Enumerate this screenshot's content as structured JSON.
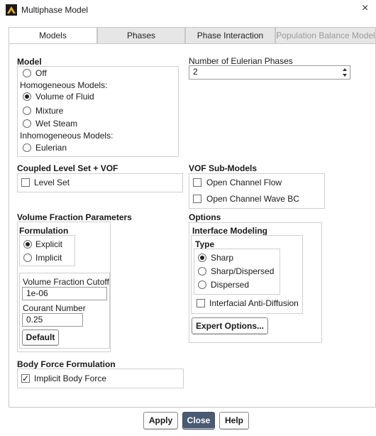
{
  "window": {
    "title": "Multiphase Model",
    "close_glyph": "×"
  },
  "tabs": [
    {
      "label": "Models",
      "active": true
    },
    {
      "label": "Phases"
    },
    {
      "label": "Phase Interaction"
    },
    {
      "label": "Population Balance Model",
      "disabled": true
    }
  ],
  "model": {
    "heading": "Model",
    "off_label": "Off",
    "homogeneous_heading": "Homogeneous Models:",
    "vof_label": "Volume of Fluid",
    "mixture_label": "Mixture",
    "wet_steam_label": "Wet Steam",
    "inhomogeneous_heading": "Inhomogeneous Models:",
    "eulerian_label": "Eulerian",
    "selected": "Volume of Fluid"
  },
  "eulerian_phases": {
    "label": "Number of Eulerian Phases",
    "value": "2"
  },
  "coupled_level_set": {
    "heading": "Coupled Level Set + VOF",
    "level_set_label": "Level Set",
    "level_set_checked": false
  },
  "vof_submodels": {
    "heading": "VOF Sub-Models",
    "open_channel_flow_label": "Open Channel Flow",
    "open_channel_wave_label": "Open Channel Wave BC"
  },
  "volume_fraction": {
    "heading": "Volume Fraction Parameters",
    "formulation_heading": "Formulation",
    "explicit_label": "Explicit",
    "implicit_label": "Implicit",
    "selected": "Explicit",
    "cutoff_label": "Volume Fraction Cutoff",
    "cutoff_value": "1e-06",
    "courant_label": "Courant Number",
    "courant_value": "0.25",
    "default_button": "Default"
  },
  "options": {
    "heading": "Options",
    "interface_heading": "Interface Modeling",
    "type_heading": "Type",
    "sharp_label": "Sharp",
    "sharp_dispersed_label": "Sharp/Dispersed",
    "dispersed_label": "Dispersed",
    "selected": "Sharp",
    "anti_diffusion_label": "Interfacial Anti-Diffusion",
    "expert_button": "Expert Options..."
  },
  "body_force": {
    "heading": "Body Force Formulation",
    "implicit_label": "Implicit Body Force",
    "implicit_checked": true,
    "check_glyph": "✓"
  },
  "footer": {
    "apply": "Apply",
    "close": "Close",
    "help": "Help"
  },
  "colors": {
    "close_button_bg": "#4a5a72"
  },
  "icons": {
    "app": "ansys-fluent-icon"
  }
}
